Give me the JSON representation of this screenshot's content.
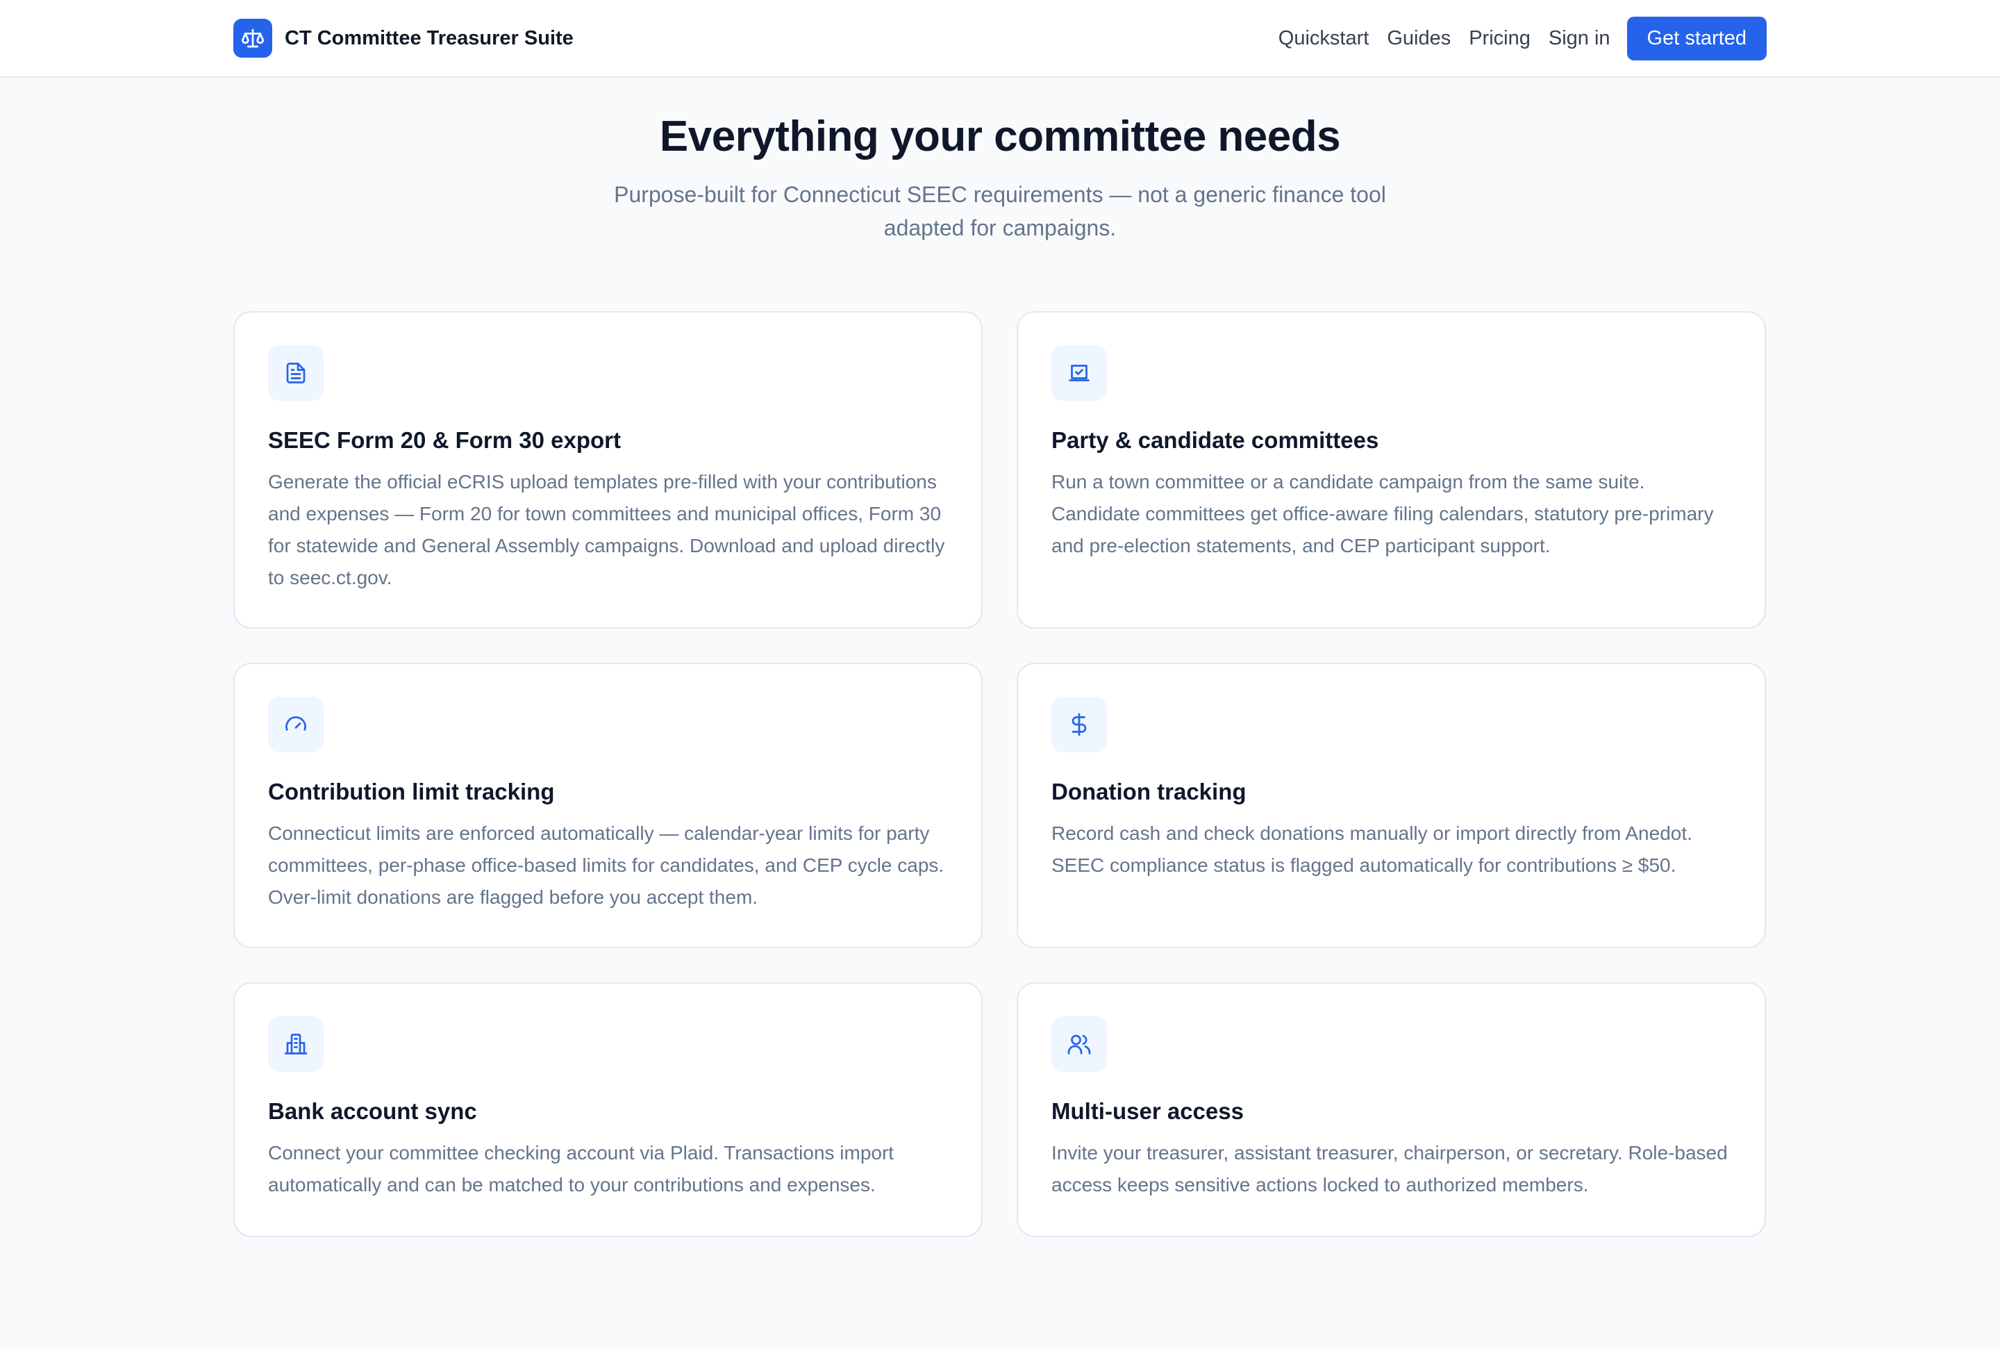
{
  "nav": {
    "brand": "CT Committee Treasurer Suite",
    "brand_icon": "scales-icon",
    "links": [
      "Quickstart",
      "Guides",
      "Pricing",
      "Sign in"
    ],
    "cta": "Get started"
  },
  "hero": {
    "title": "Everything your committee needs",
    "subtitle": "Purpose-built for Connecticut SEEC requirements — not a generic finance tool adapted for campaigns."
  },
  "features": [
    {
      "icon": "document-icon",
      "title": "SEEC Form 20 & Form 30 export",
      "description": "Generate the official eCRIS upload templates pre-filled with your contributions and expenses — Form 20 for town committees and municipal offices, Form 30 for statewide and General Assembly campaigns. Download and upload directly to seec.ct.gov."
    },
    {
      "icon": "ballot-box-icon",
      "title": "Party & candidate committees",
      "description": "Run a town committee or a candidate campaign from the same suite. Candidate committees get office-aware filing calendars, statutory pre-primary and pre-election statements, and CEP participant support."
    },
    {
      "icon": "gauge-icon",
      "title": "Contribution limit tracking",
      "description": "Connecticut limits are enforced automatically — calendar-year limits for party committees, per-phase office-based limits for candidates, and CEP cycle caps. Over-limit donations are flagged before you accept them."
    },
    {
      "icon": "dollar-icon",
      "title": "Donation tracking",
      "description": "Record cash and check donations manually or import directly from Anedot. SEEC compliance status is flagged automatically for contributions ≥ $50."
    },
    {
      "icon": "bank-building-icon",
      "title": "Bank account sync",
      "description": "Connect your committee checking account via Plaid. Transactions import automatically and can be matched to your contributions and expenses."
    },
    {
      "icon": "users-icon",
      "title": "Multi-user access",
      "description": "Invite your treasurer, assistant treasurer, chairperson, or secretary. Role-based access keeps sensitive actions locked to authorized members."
    }
  ],
  "colors": {
    "accent": "#2563eb",
    "icon_bg": "#eff6ff",
    "text": "#0f172a",
    "muted": "#64748b",
    "border": "#e2e8f0",
    "page_bg": "#f8fafc"
  }
}
